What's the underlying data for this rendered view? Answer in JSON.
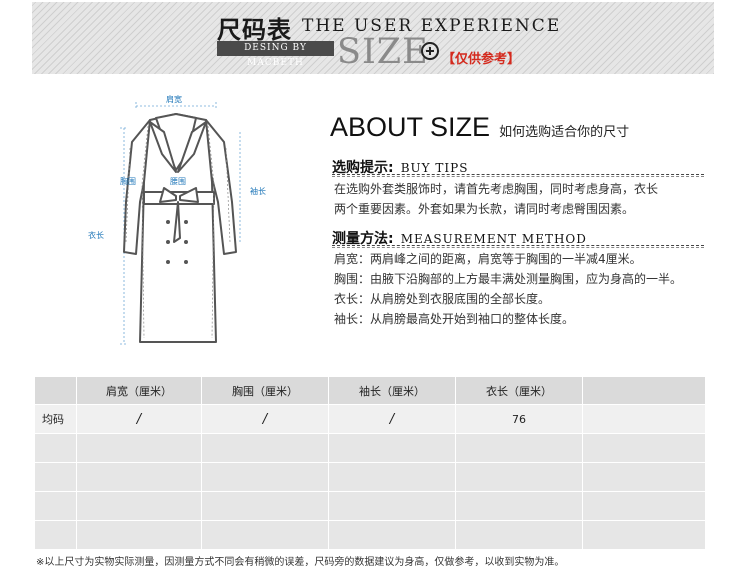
{
  "header": {
    "title_cn": "尺码表",
    "title_en": "THE USER EXPERIENCE",
    "designer_tag": "DESING BY MACBETH",
    "size_word": "SIZE",
    "reference_note": "【仅供参考】"
  },
  "illustration": {
    "labels": {
      "shoulder": "肩宽",
      "chest": "胸围",
      "waist": "腰围",
      "sleeve": "袖长",
      "length": "衣长"
    }
  },
  "about": {
    "title": "ABOUT SIZE",
    "subtitle": "如何选购适合你的尺寸"
  },
  "buy_tips": {
    "title_cn": "选购提示:",
    "title_en": "BUY TIPS",
    "lines": [
      "在选购外套类服饰时，请首先考虑胸围，同时考虑身高，衣长",
      "两个重要因素。外套如果为长款，请同时考虑臀围因素。"
    ]
  },
  "measurement": {
    "title_cn": "测量方法:",
    "title_en": "MEASUREMENT METHOD",
    "lines": [
      "肩宽：两肩峰之间的距离，肩宽等于胸围的一半减4厘米。",
      "胸围：由腋下沿胸部的上方最丰满处测量胸围，应为身高的一半。",
      "衣长：从肩膀处到衣服底围的全部长度。",
      "袖长：从肩膀最高处开始到袖口的整体长度。"
    ]
  },
  "size_table": {
    "headers": [
      "",
      "肩宽（厘米）",
      "胸围（厘米）",
      "袖长（厘米）",
      "衣长（厘米）",
      ""
    ],
    "rows": [
      [
        "均码",
        "/",
        "/",
        "/",
        "76",
        ""
      ],
      [
        "",
        "",
        "",
        "",
        "",
        ""
      ],
      [
        "",
        "",
        "",
        "",
        "",
        ""
      ],
      [
        "",
        "",
        "",
        "",
        "",
        ""
      ],
      [
        "",
        "",
        "",
        "",
        "",
        ""
      ]
    ]
  },
  "footnote": "※以上尺寸为实物实际测量，因测量方式不同会有稍微的误差，尺码旁的数据建议为身高，仅做参考，以收到实物为准。"
}
